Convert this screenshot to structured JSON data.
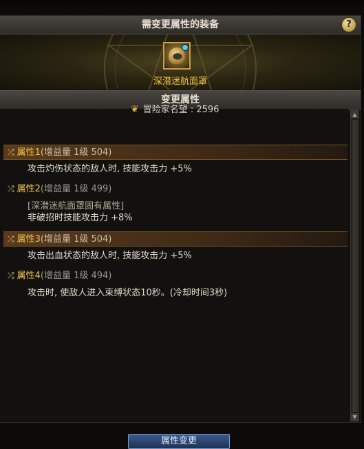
{
  "header": {
    "title": "需变更属性的装备",
    "help_label": "?"
  },
  "equipment": {
    "name": "深潜迷航面罩",
    "icon": "helmet-icon"
  },
  "section": {
    "title": "变更属性"
  },
  "fame": {
    "icon": "fame-emblem-icon",
    "text": "冒险家名望 : 2596"
  },
  "attributes": [
    {
      "label": "属性1",
      "meta": "(增益量 1级 504)",
      "highlighted": true,
      "lines": [
        "攻击灼伤状态的敌人时, 技能攻击力 +5%"
      ]
    },
    {
      "label": "属性2",
      "meta": "(增益量 1级 499)",
      "highlighted": false,
      "fixed_note": "[深潜迷航面罩固有属性]",
      "lines": [
        "非破招时技能攻击力 +8%"
      ]
    },
    {
      "label": "属性3",
      "meta": "(增益量 1级 504)",
      "highlighted": true,
      "lines": [
        "攻击出血状态的敌人时, 技能攻击力 +5%"
      ]
    },
    {
      "label": "属性4",
      "meta": "(增益量 1级 494)",
      "highlighted": false,
      "lines": [
        "攻击时, 使敌人进入束缚状态10秒。(冷却时间3秒)"
      ]
    }
  ],
  "bottom_button": {
    "label": "属性变更"
  },
  "colors": {
    "accent_gold": "#f2c64a",
    "equip_name": "#f0c23c",
    "button_blue": "#2a4674"
  }
}
